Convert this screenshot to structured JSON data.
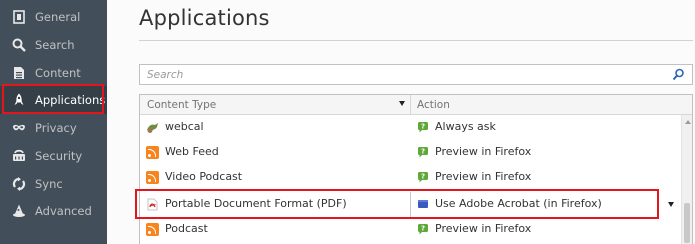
{
  "sidebar": {
    "items": [
      {
        "label": "General",
        "icon": "general-icon"
      },
      {
        "label": "Search",
        "icon": "search-icon"
      },
      {
        "label": "Content",
        "icon": "content-icon"
      },
      {
        "label": "Applications",
        "icon": "rocket-icon",
        "active": true
      },
      {
        "label": "Privacy",
        "icon": "mask-icon"
      },
      {
        "label": "Security",
        "icon": "security-icon"
      },
      {
        "label": "Sync",
        "icon": "sync-icon"
      },
      {
        "label": "Advanced",
        "icon": "wizard-hat-icon"
      }
    ]
  },
  "main": {
    "title": "Applications",
    "search_placeholder": "Search",
    "table": {
      "col_type": "Content Type",
      "col_action": "Action",
      "rows": [
        {
          "type": "webcal",
          "action": "Always ask",
          "type_icon": "webcal-icon",
          "action_icon": "ask-icon"
        },
        {
          "type": "Web Feed",
          "action": "Preview in Firefox",
          "type_icon": "feed-icon",
          "action_icon": "preview-icon"
        },
        {
          "type": "Video Podcast",
          "action": "Preview in Firefox",
          "type_icon": "feed-icon",
          "action_icon": "preview-icon"
        },
        {
          "type": "Portable Document Format (PDF)",
          "action": "Use Adobe Acrobat (in Firefox)",
          "type_icon": "pdf-icon",
          "action_icon": "acrobat-icon",
          "selected": true
        },
        {
          "type": "Podcast",
          "action": "Preview in Firefox",
          "type_icon": "feed-icon",
          "action_icon": "preview-icon"
        }
      ]
    }
  },
  "colors": {
    "sidebar_bg": "#424f5a",
    "sidebar_active_bg": "#343f48",
    "highlight": "#e2161b",
    "feed_orange": "#f7841c",
    "acrobat_blue": "#3a5bbd"
  }
}
